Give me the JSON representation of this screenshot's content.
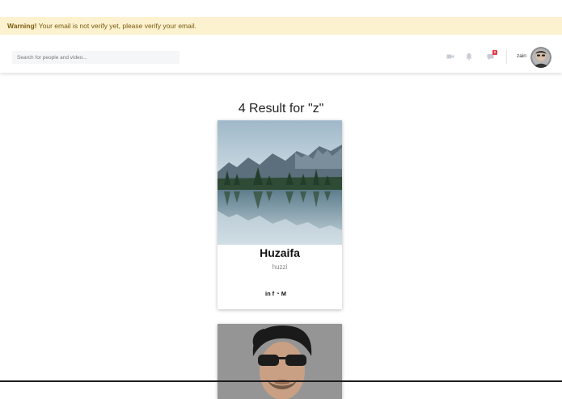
{
  "warning": {
    "strong": "Warning!",
    "message": " Your email is not verify yet, please verify your email."
  },
  "header": {
    "search_placeholder": "Search for people and video...",
    "icons": [
      "video-icon",
      "bell-icon",
      "message-icon"
    ],
    "message_badge": "9",
    "username": "zain",
    "colors": {
      "badge": "#e33a4a",
      "icon": "#c7ccd6"
    }
  },
  "results": {
    "title": "4 Result for \"z\"",
    "cards": [
      {
        "name": "Huzaifa",
        "handle": "huzzi",
        "socials": [
          {
            "icon": "linkedin-icon",
            "glyph": "in"
          },
          {
            "icon": "facebook-icon",
            "glyph": "f"
          },
          {
            "icon": "github-icon",
            "glyph": "◔"
          },
          {
            "icon": "medium-icon",
            "glyph": "M"
          }
        ]
      },
      {
        "name": "",
        "handle": ""
      }
    ]
  }
}
